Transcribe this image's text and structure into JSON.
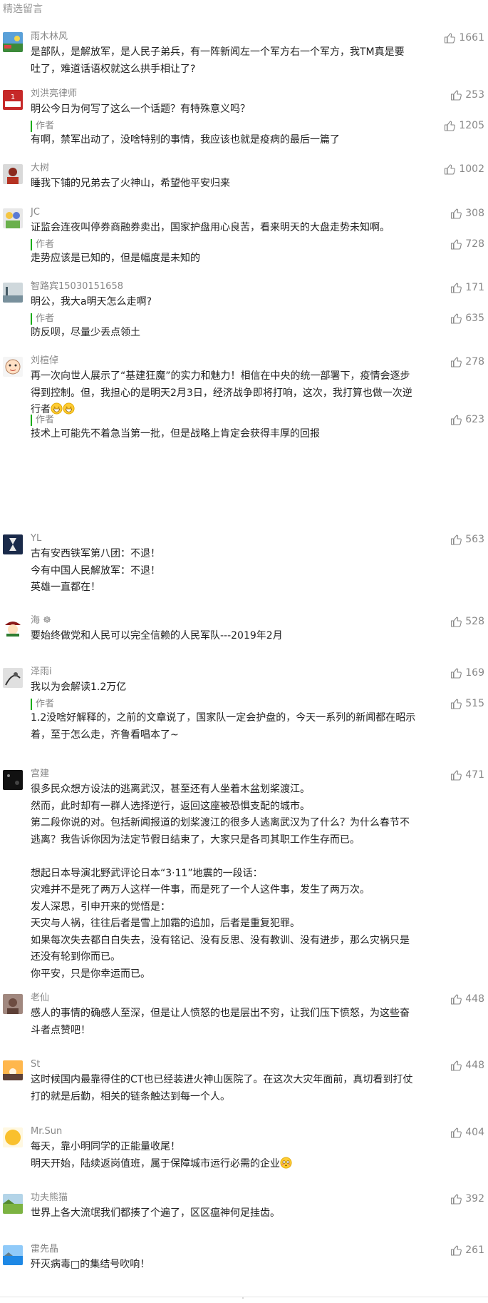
{
  "section_title": "精选留言",
  "colors": {
    "accent": "#1aad19",
    "meta": "#888888",
    "text": "#222222"
  },
  "comments": [
    {
      "nick": "雨木林风",
      "likes": "1661",
      "avatar_icon": "landscape-avatar-icon",
      "content": "是部队，是解放军，是人民子弟兵，有一阵新闻左一个军方右一个军方，我TM真是要\n吐了，难道话语权就这么拱手相让了?"
    },
    {
      "nick": "刘洪亮律师",
      "likes": "253",
      "avatar_icon": "law-logo-avatar-icon",
      "content": "明公今日为何写了这么一个话题？有特殊意义吗？",
      "reply": {
        "label": "作者",
        "likes": "1205",
        "content": "有啊，禁军出动了，没啥特别的事情，我应该也就是疫病的最后一篇了"
      }
    },
    {
      "nick": "大树",
      "likes": "1002",
      "avatar_icon": "person-avatar-icon",
      "content": "睡我下铺的兄弟去了火神山，希望他平安归来"
    },
    {
      "nick": "JC",
      "likes": "308",
      "avatar_icon": "figure-avatar-icon",
      "content": "证监会连夜叫停券商融券卖出，国家护盘用心良苦，看来明天的大盘走势未知啊。",
      "reply": {
        "label": "作者",
        "likes": "728",
        "content": "走势应该是已知的，但是幅度是未知的"
      }
    },
    {
      "nick": "智路宾15030151658",
      "likes": "171",
      "avatar_icon": "road-avatar-icon",
      "content": "明公，我大a明天怎么走啊?",
      "reply": {
        "label": "作者",
        "likes": "635",
        "content": "防反呗，尽量少丢点领土"
      }
    },
    {
      "nick": "刘楦倬",
      "likes": "278",
      "avatar_icon": "cartoon-avatar-icon",
      "content": "再一次向世人展示了“基建狂魔”的实力和魅力！相信在中央的统一部署下，疫情会逐步\n得到控制。但，我担心的是明天2月3日，经济战争即将打响，这次，我打算也做一次逆\n行者",
      "emojis": [
        "grin-emoji-icon",
        "grin-emoji-icon"
      ],
      "reply": {
        "label": "作者",
        "likes": "623",
        "content": "技术上可能先不着急当第一批，但是战略上肯定会获得丰厚的回报"
      }
    },
    {
      "nick": "YL",
      "likes": "563",
      "avatar_icon": "hourglass-avatar-icon",
      "content": "古有安西铁军第八团：不退！\n今有中国人民解放军：不退！\n英雄一直都在！"
    },
    {
      "nick": "海 ☸︎",
      "likes": "528",
      "avatar_icon": "hat-avatar-icon",
      "content": "要始终做党和人民可以完全信赖的人民军队---2019年2月"
    },
    {
      "nick": "泽雨i",
      "likes": "169",
      "avatar_icon": "sketch-avatar-icon",
      "content": "我以为会解读1.2万亿",
      "reply": {
        "label": "作者",
        "likes": "515",
        "content": "1.2没啥好解释的，之前的文章说了，国家队一定会护盘的，今天一系列的新闻都在昭示\n着，至于怎么走，齐鲁看唱本了~"
      }
    },
    {
      "nick": "宫建",
      "likes": "471",
      "avatar_icon": "dark-avatar-icon",
      "content": "很多民众想方设法的逃离武汉，甚至还有人坐着木盆划桨渡江。\n然而，此时却有一群人选择逆行，返回这座被恐惧支配的城市。\n第二段你说的对。包括新闻报道的划桨渡江的很多人逃离武汉为了什么？为什么春节不\n逃离？我告诉你因为法定节假日结束了，大家只是各司其职工作生存而已。\n\n想起日本导演北野武评论日本“3·11”地震的一段话：\n灾难并不是死了两万人这样一件事，而是死了一个人这件事，发生了两万次。\n发人深思，引申开来的觉悟是：\n天灾与人祸，往往后者是雪上加霜的追加，后者是重复犯罪。\n如果每次失去都白白失去，没有铭记、没有反思、没有教训、没有进步，那么灾祸只是\n还没有轮到你而已。\n你平安，只是你幸运而已。"
    },
    {
      "nick": "老仙",
      "likes": "448",
      "avatar_icon": "brown-avatar-icon",
      "content": "感人的事情的确感人至深，但是让人愤怒的也是层出不穷，让我们压下愤怒，为这些奋\n斗者点赞吧！"
    },
    {
      "nick": "St",
      "likes": "448",
      "avatar_icon": "sunset-avatar-icon",
      "content": "这时候国内最靠得住的CT也已经装进火神山医院了。在这次大灾年面前，真切看到打仗\n打的就是后勤，相关的链条触达到每一个人。"
    },
    {
      "nick": "Mr.Sun",
      "likes": "404",
      "avatar_icon": "sun-avatar-icon",
      "content": "每天，靠小明同学的正能量收尾！\n明天开始，陆续返岗值班，属于保障城市运行必需的企业",
      "emojis": [
        "flushed-emoji-icon"
      ]
    },
    {
      "nick": "功夫熊猫",
      "likes": "392",
      "avatar_icon": "field-avatar-icon",
      "content": "世界上各大流氓我们都揍了个遍了，区区瘟神何足挂齿。"
    },
    {
      "nick": "雷先晶",
      "likes": "261",
      "avatar_icon": "lake-avatar-icon",
      "content": "歼灭病毒□的集结号吹响！"
    }
  ]
}
